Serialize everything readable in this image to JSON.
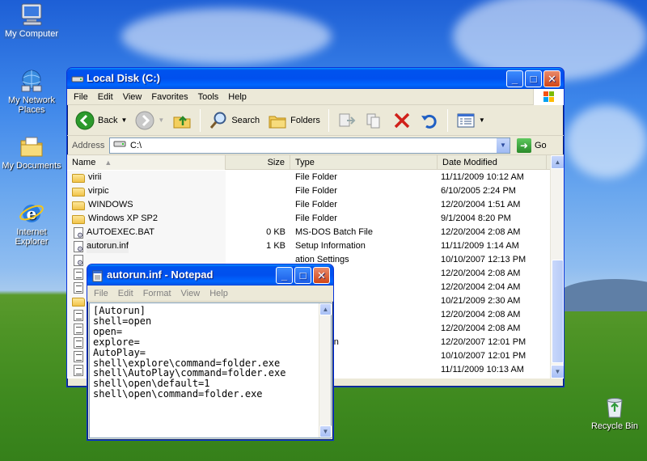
{
  "desktop": {
    "icons": [
      {
        "label": "My Computer",
        "icon": "computer-icon"
      },
      {
        "label": "My Network Places",
        "icon": "network-icon"
      },
      {
        "label": "My Documents",
        "icon": "documents-folder-icon"
      },
      {
        "label": "Internet Explorer",
        "icon": "internet-explorer-icon"
      },
      {
        "label": "Recycle Bin",
        "icon": "recycle-bin-icon"
      }
    ]
  },
  "explorer": {
    "title": "Local Disk (C:)",
    "menu": [
      "File",
      "Edit",
      "View",
      "Favorites",
      "Tools",
      "Help"
    ],
    "toolbar": {
      "back": "Back",
      "search": "Search",
      "folders": "Folders"
    },
    "address": {
      "label": "Address",
      "value": "C:\\",
      "go": "Go"
    },
    "columns": {
      "name": "Name",
      "size": "Size",
      "type": "Type",
      "date": "Date Modified"
    },
    "rows": [
      {
        "name": "virii",
        "size": "",
        "type": "File Folder",
        "date": "11/11/2009 10:12 AM",
        "icon": "folder"
      },
      {
        "name": "virpic",
        "size": "",
        "type": "File Folder",
        "date": "6/10/2005 2:24 PM",
        "icon": "folder"
      },
      {
        "name": "WINDOWS",
        "size": "",
        "type": "File Folder",
        "date": "12/20/2004 1:51 AM",
        "icon": "folder"
      },
      {
        "name": "Windows XP SP2",
        "size": "",
        "type": "File Folder",
        "date": "9/1/2004 8:20 PM",
        "icon": "folder"
      },
      {
        "name": "AUTOEXEC.BAT",
        "size": "0 KB",
        "type": "MS-DOS Batch File",
        "date": "12/20/2004 2:08 AM",
        "icon": "cfg"
      },
      {
        "name": "autorun.inf",
        "size": "1 KB",
        "type": "Setup Information",
        "date": "11/11/2009 1:14 AM",
        "icon": "cfg"
      },
      {
        "name": "",
        "size": "",
        "type": "ation Settings",
        "date": "10/10/2007 12:13 PM",
        "icon": "cfg"
      },
      {
        "name": "",
        "size": "",
        "type": "e",
        "date": "12/20/2004 2:08 AM",
        "icon": "doc"
      },
      {
        "name": "",
        "size": "",
        "type": "ument",
        "date": "12/20/2004 2:04 AM",
        "icon": "doc"
      },
      {
        "name": "",
        "size": "",
        "type": "n",
        "date": "10/21/2009 2:30 AM",
        "icon": "folder"
      },
      {
        "name": "",
        "size": "",
        "type": "e",
        "date": "12/20/2004 2:08 AM",
        "icon": "doc"
      },
      {
        "name": "",
        "size": "",
        "type": "e",
        "date": "12/20/2004 2:08 AM",
        "icon": "doc"
      },
      {
        "name": "",
        "size": "",
        "type": "Application",
        "date": "12/20/2007 12:01 PM",
        "icon": "doc"
      },
      {
        "name": "",
        "size": "",
        "type": "e",
        "date": "10/10/2007 12:01 PM",
        "icon": "doc"
      },
      {
        "name": "",
        "size": "",
        "type": "e",
        "date": "11/11/2009 10:13 AM",
        "icon": "doc"
      }
    ]
  },
  "notepad": {
    "title": "autorun.inf - Notepad",
    "menu": [
      "File",
      "Edit",
      "Format",
      "View",
      "Help"
    ],
    "text": "[Autorun]\nshell=open\nopen=\nexplore=\nAutoPlay=\nshell\\explore\\command=folder.exe\nshell\\AutoPlay\\command=folder.exe\nshell\\open\\default=1\nshell\\open\\command=folder.exe"
  },
  "colors": {
    "title_active": "#0054e3",
    "selection": "#316ac5"
  }
}
